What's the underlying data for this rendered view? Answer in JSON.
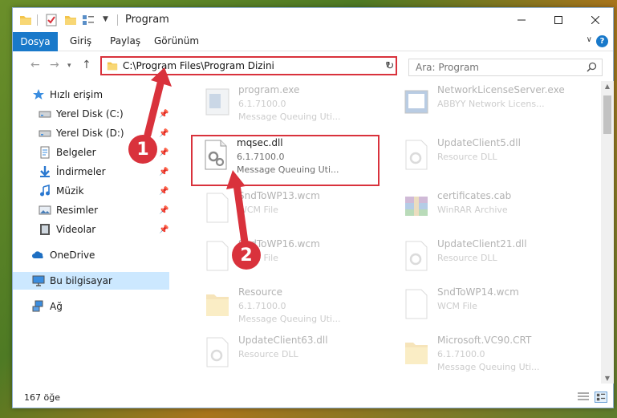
{
  "window": {
    "title": "Program"
  },
  "ribbon": {
    "tabs": [
      "Dosya",
      "Giriş",
      "Paylaş",
      "Görünüm"
    ],
    "help": "?"
  },
  "nav": {
    "back": "←",
    "forward": "→",
    "recent": "▾",
    "up": "↑",
    "refresh": "↻"
  },
  "address": {
    "path": "C:\\Program Files\\Program Dizini"
  },
  "search": {
    "placeholder": "Ara: Program"
  },
  "sidebar": {
    "items": [
      {
        "label": "Hızlı erişim",
        "icon": "star-icon"
      },
      {
        "label": "Yerel Disk (C:)",
        "icon": "drive-icon"
      },
      {
        "label": "Yerel Disk (D:)",
        "icon": "drive-icon"
      },
      {
        "label": "Belgeler",
        "icon": "documents-icon"
      },
      {
        "label": "İndirmeler",
        "icon": "download-icon"
      },
      {
        "label": "Müzik",
        "icon": "music-icon"
      },
      {
        "label": "Resimler",
        "icon": "pictures-icon"
      },
      {
        "label": "Videolar",
        "icon": "videos-icon"
      },
      {
        "label": "OneDrive",
        "icon": "cloud-icon"
      },
      {
        "label": "Bu bilgisayar",
        "icon": "computer-icon"
      },
      {
        "label": "Ağ",
        "icon": "network-icon"
      }
    ]
  },
  "files": [
    {
      "name": "program.exe",
      "version": "6.1.7100.0",
      "desc": "Message Queuing Uti..."
    },
    {
      "name": "NetworkLicenseServer.exe",
      "version": "ABBYY Network Licens...",
      "desc": ""
    },
    {
      "name": "mqsec.dll",
      "version": "6.1.7100.0",
      "desc": "Message Queuing Uti..."
    },
    {
      "name": "UpdateClient5.dll",
      "version": "Resource DLL",
      "desc": ""
    },
    {
      "name": "SndToWP13.wcm",
      "version": "WCM File",
      "desc": ""
    },
    {
      "name": "certificates.cab",
      "version": "WinRAR Archive",
      "desc": ""
    },
    {
      "name": "SndToWP16.wcm",
      "version": "WCM File",
      "desc": ""
    },
    {
      "name": "UpdateClient21.dll",
      "version": "Resource DLL",
      "desc": ""
    },
    {
      "name": "Resource",
      "version": "6.1.7100.0",
      "desc": "Message Queuing Uti..."
    },
    {
      "name": "SndToWP14.wcm",
      "version": "WCM File",
      "desc": ""
    },
    {
      "name": "UpdateClient63.dll",
      "version": "Resource DLL",
      "desc": ""
    },
    {
      "name": "Microsoft.VC90.CRT",
      "version": "6.1.7100.0",
      "desc": "Message Queuing Uti..."
    }
  ],
  "status": {
    "count": "167 öğe"
  },
  "annotations": {
    "step1": "1",
    "step2": "2"
  },
  "colors": {
    "accent": "#1979ca",
    "annotation": "#d9323c",
    "selection": "#cce8ff"
  }
}
